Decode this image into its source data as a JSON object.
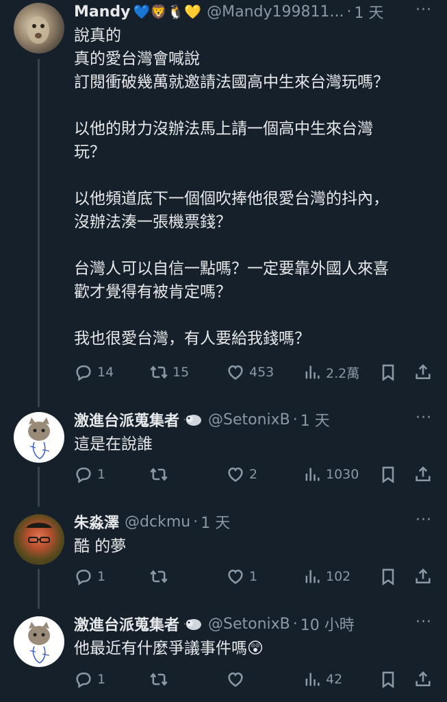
{
  "tweets": [
    {
      "name": "Mandy",
      "emojis": "💙🦁🐧💛",
      "handle": "@Mandy199811...",
      "dot": "·",
      "time": "1 天",
      "more": "···",
      "text": "說真的\n真的愛台灣會喊說\n訂閱衝破幾萬就邀請法國高中生來台灣玩嗎？\n\n以他的財力沒辦法馬上請一個高中生來台灣\n玩？\n\n以他頻道底下一個個吹捧他很愛台灣的抖內，\n沒辦法湊一張機票錢？\n\n台灣人可以自信一點嗎？一定要靠外國人來喜\n歡才覺得有被肯定嗎？\n\n我也很愛台灣，有人要給我錢嗎？",
      "replies": "14",
      "retweets": "15",
      "likes": "453",
      "views": "2.2萬"
    },
    {
      "name": "激進台派蒐集者",
      "handle": "@SetonixB",
      "dot": "·",
      "time": "1 天",
      "more": "···",
      "text": "這是在說誰",
      "replies": "1",
      "retweets": "",
      "likes": "2",
      "views": "1030"
    },
    {
      "name": "朱淼澤",
      "handle": "@dckmu",
      "dot": "·",
      "time": "1 天",
      "more": "···",
      "text": "酷 的夢",
      "replies": "1",
      "retweets": "",
      "likes": "1",
      "views": "102"
    },
    {
      "name": "激進台派蒐集者",
      "handle": "@SetonixB",
      "dot": "·",
      "time": "10 小時",
      "more": "···",
      "text": "他最近有什麼爭議事件嗎😲",
      "replies": "1",
      "retweets": "",
      "likes": "",
      "views": "42"
    }
  ],
  "colors": {
    "background": "#15202b",
    "text": "#e7e9ea",
    "muted": "#8b98a5",
    "thread": "#38444d"
  },
  "icons": [
    "reply-icon",
    "retweet-icon",
    "like-icon",
    "views-icon",
    "bookmark-icon",
    "share-icon",
    "more-icon"
  ]
}
